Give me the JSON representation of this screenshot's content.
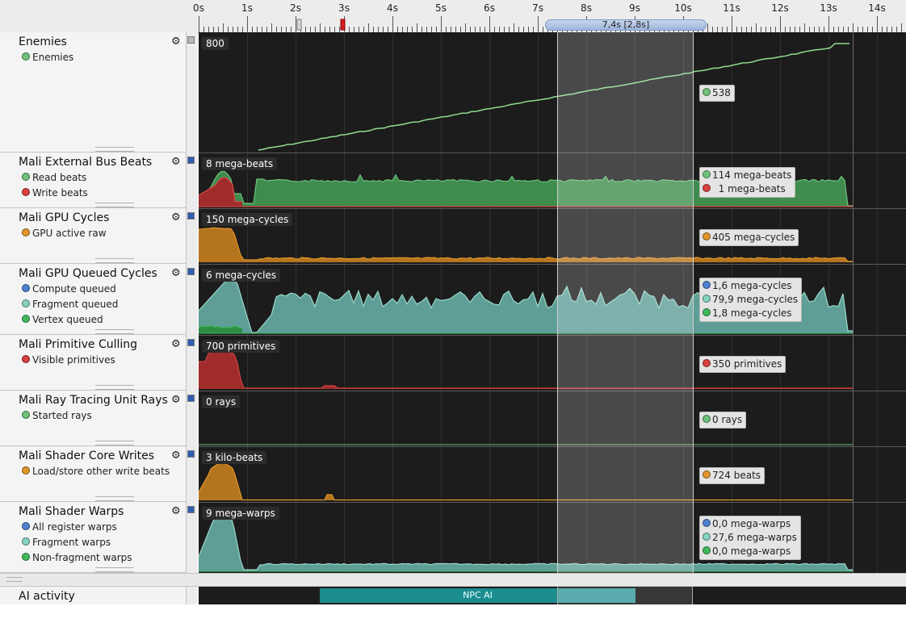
{
  "ruler": {
    "ticks": [
      "0s",
      "1s",
      "2s",
      "3s",
      "4s",
      "5s",
      "6s",
      "7s",
      "8s",
      "9s",
      "10s",
      "11s",
      "12s",
      "13s",
      "14s"
    ],
    "selection_label": "7,4s [2,8s]"
  },
  "selection_color": "#ffffff",
  "rows": [
    {
      "id": "enemies",
      "title": "Enemies",
      "scale_label": "800",
      "legend": [
        {
          "name": "Enemies",
          "color": "#6ec27a"
        }
      ],
      "values": [
        {
          "color": "#6ec27a",
          "text": "538"
        }
      ],
      "box": "gray",
      "series_kind": "line"
    },
    {
      "id": "external-bus",
      "title": "Mali External Bus Beats",
      "scale_label": "8 mega-beats",
      "legend": [
        {
          "name": "Read beats",
          "color": "#6ec27a"
        },
        {
          "name": "Write beats",
          "color": "#d94040"
        }
      ],
      "values": [
        {
          "color": "#6ec27a",
          "text": "114 mega-beats"
        },
        {
          "color": "#d94040",
          "text": "  1 mega-beats"
        }
      ],
      "box": "blue"
    },
    {
      "id": "gpu-cycles",
      "title": "Mali GPU Cycles",
      "scale_label": "150 mega-cycles",
      "legend": [
        {
          "name": "GPU active raw",
          "color": "#e0962a"
        }
      ],
      "values": [
        {
          "color": "#e0962a",
          "text": "405 mega-cycles"
        }
      ],
      "box": "blue"
    },
    {
      "id": "gpu-queued",
      "title": "Mali GPU Queued Cycles",
      "scale_label": "6 mega-cycles",
      "legend": [
        {
          "name": "Compute queued",
          "color": "#4f80d0"
        },
        {
          "name": "Fragment queued",
          "color": "#86d2c0"
        },
        {
          "name": "Vertex queued",
          "color": "#3fb85a"
        }
      ],
      "values": [
        {
          "color": "#4f80d0",
          "text": "1,6 mega-cycles"
        },
        {
          "color": "#86d2c0",
          "text": "79,9 mega-cycles"
        },
        {
          "color": "#3fb85a",
          "text": "1,8 mega-cycles"
        }
      ],
      "box": "blue"
    },
    {
      "id": "primitive-culling",
      "title": "Mali Primitive Culling",
      "scale_label": "700 primitives",
      "legend": [
        {
          "name": "Visible primitives",
          "color": "#d94040"
        }
      ],
      "values": [
        {
          "color": "#d94040",
          "text": "350 primitives"
        }
      ],
      "box": "blue"
    },
    {
      "id": "ray-tracing",
      "title": "Mali Ray Tracing Unit Rays",
      "scale_label": "0 rays",
      "legend": [
        {
          "name": "Started rays",
          "color": "#6ec27a"
        }
      ],
      "values": [
        {
          "color": "#6ec27a",
          "text": "0 rays"
        }
      ],
      "box": "blue"
    },
    {
      "id": "shader-writes",
      "title": "Mali Shader Core Writes",
      "scale_label": "3 kilo-beats",
      "legend": [
        {
          "name": "Load/store other write beats",
          "color": "#e0962a"
        }
      ],
      "values": [
        {
          "color": "#e0962a",
          "text": "724 beats"
        }
      ],
      "box": "blue"
    },
    {
      "id": "shader-warps",
      "title": "Mali Shader Warps",
      "scale_label": "9 mega-warps",
      "legend": [
        {
          "name": "All register warps",
          "color": "#4f80d0"
        },
        {
          "name": "Fragment warps",
          "color": "#86d2c0"
        },
        {
          "name": "Non-fragment warps",
          "color": "#3fb85a"
        }
      ],
      "values": [
        {
          "color": "#4f80d0",
          "text": "0,0 mega-warps"
        },
        {
          "color": "#86d2c0",
          "text": "27,6 mega-warps"
        },
        {
          "color": "#3fb85a",
          "text": "0,0 mega-warps"
        }
      ],
      "box": "blue"
    }
  ],
  "activity": {
    "label": "AI activity",
    "bar_label": "NPC AI"
  }
}
